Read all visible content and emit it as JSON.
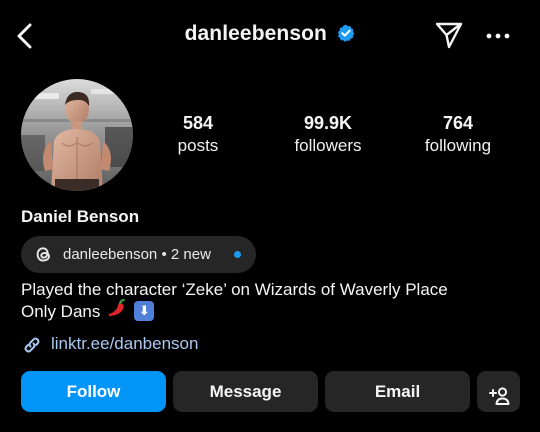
{
  "header": {
    "username": "danleebenson",
    "verified": true,
    "back_icon": "chevron-left-icon",
    "send_icon": "paper-plane-icon",
    "more_icon": "more-horizontal-icon"
  },
  "profile": {
    "full_name": "Daniel Benson",
    "stats": [
      {
        "value": "584",
        "label": "posts"
      },
      {
        "value": "99.9K",
        "label": "followers"
      },
      {
        "value": "764",
        "label": "following"
      }
    ]
  },
  "threads": {
    "handle": "danleebenson",
    "separator": "•",
    "status": "2 new",
    "badge_color": "#1d9bf0"
  },
  "bio": {
    "line1": "Played the character ‘Zeke’ on Wizards of Waverly Place",
    "line2": "Only Dans",
    "emojis": [
      "hot-pepper-emoji",
      "down-arrow-emoji"
    ]
  },
  "link": {
    "text": "linktr.ee/danbenson"
  },
  "actions": {
    "follow": "Follow",
    "message": "Message",
    "email": "Email",
    "add_icon": "add-person-icon"
  },
  "colors": {
    "background": "#000000",
    "accent": "#0095f6",
    "button_bg": "#262626",
    "link": "#a9c8f0"
  }
}
